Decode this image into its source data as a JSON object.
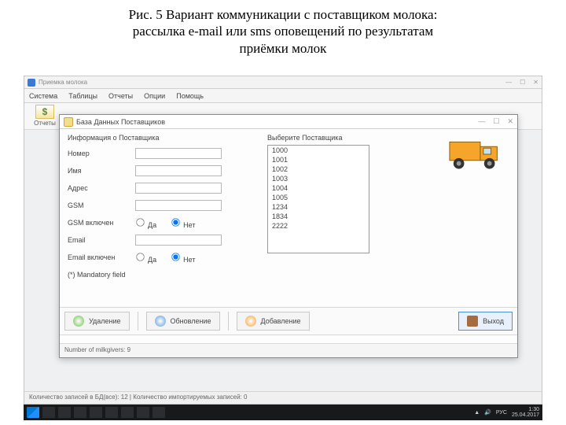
{
  "caption": {
    "line1": "Рис. 5 Вариант коммуникации с поставщиком молока:",
    "line2": "рассылка e-mail или sms оповещений по результатам",
    "line3": "приёмки молок"
  },
  "mainwin": {
    "title": "Приемка молока",
    "menu": [
      "Система",
      "Таблицы",
      "Отчеты",
      "Опции",
      "Помощь"
    ],
    "tool_reports": "Отчеты",
    "statusbar": "Количество записей в БД(все): 12  |  Количество импортируемых записей: 0"
  },
  "wincontrols": {
    "min": "—",
    "max": "☐",
    "close": "✕"
  },
  "dialog": {
    "title": "База Данных Поставщиков",
    "info_section": "Информация о Поставщика",
    "labels": {
      "number": "Номер",
      "name": "Имя",
      "address": "Адрес",
      "gsm": "GSM",
      "gsm_on": "GSM включен",
      "email": "Email",
      "email_on": "Email включен"
    },
    "radio": {
      "yes": "Да",
      "no": "Нет"
    },
    "select_supplier": "Выберите Поставщика",
    "suppliers": [
      "1000",
      "1001",
      "1002",
      "1003",
      "1004",
      "1005",
      "1234",
      "1834",
      "2222"
    ],
    "mandatory": "(*) Mandatory field",
    "buttons": {
      "delete": "Удаление",
      "update": "Обновление",
      "add": "Добавление",
      "exit": "Выход"
    },
    "status": "Number of milkgivers: 9"
  },
  "taskbar": {
    "lang": "РУС",
    "time": "1:30",
    "date": "25.04.2017"
  }
}
